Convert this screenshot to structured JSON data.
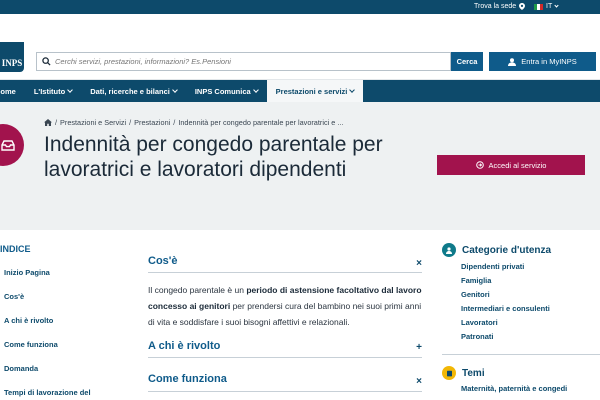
{
  "topbar": {
    "find_office": "Trova la sede",
    "language": "IT"
  },
  "header": {
    "logo_text": "INPS",
    "search_placeholder": "Cerchi servizi, prestazioni, informazioni? Es.Pensioni",
    "search_button": "Cerca",
    "login_button": "Entra in MyINPS"
  },
  "nav": {
    "items": [
      {
        "label": "Home"
      },
      {
        "label": "L'Istituto"
      },
      {
        "label": "Dati, ricerche e bilanci"
      },
      {
        "label": "INPS Comunica"
      },
      {
        "label": "Prestazioni e servizi"
      }
    ]
  },
  "breadcrumb": {
    "parts": [
      "Prestazioni e Servizi",
      "Prestazioni",
      "Indennità per congedo parentale per lavoratrici e ..."
    ]
  },
  "page": {
    "title": "Indennità per congedo parentale per lavoratrici e lavoratori dipendenti",
    "access_button": "Accedi al servizio"
  },
  "index": {
    "heading": "INDICE",
    "items": [
      "Inizio Pagina",
      "Cos'è",
      "A chi è rivolto",
      "Come funziona",
      "Domanda",
      "Tempi di lavorazione del"
    ]
  },
  "sections": [
    {
      "title": "Cos'è",
      "toggle": "×"
    },
    {
      "title": "A chi è rivolto",
      "toggle": "+"
    },
    {
      "title": "Come funziona",
      "toggle": "×"
    }
  ],
  "cose_text": {
    "part1": "Il congedo parentale è un ",
    "bold1": "periodo di astensione facoltativo dal lavoro concesso ai genitori",
    "part2": " per prendersi cura del bambino nei suoi primi anni di vita e soddisfare i suoi bisogni affettivi e relazionali."
  },
  "right": {
    "categories_heading": "Categorie d'utenza",
    "categories": [
      "Dipendenti privati",
      "Famiglia",
      "Genitori",
      "Intermediari e consulenti",
      "Lavoratori",
      "Patronati"
    ],
    "themes_heading": "Temi",
    "themes": [
      "Maternità, paternità e congedi"
    ]
  },
  "colors": {
    "navy": "#0d4a6b",
    "blue": "#0f5b8a",
    "brand_red": "#a2134d",
    "teal": "#0f7a8a",
    "yellow": "#f2b705"
  }
}
